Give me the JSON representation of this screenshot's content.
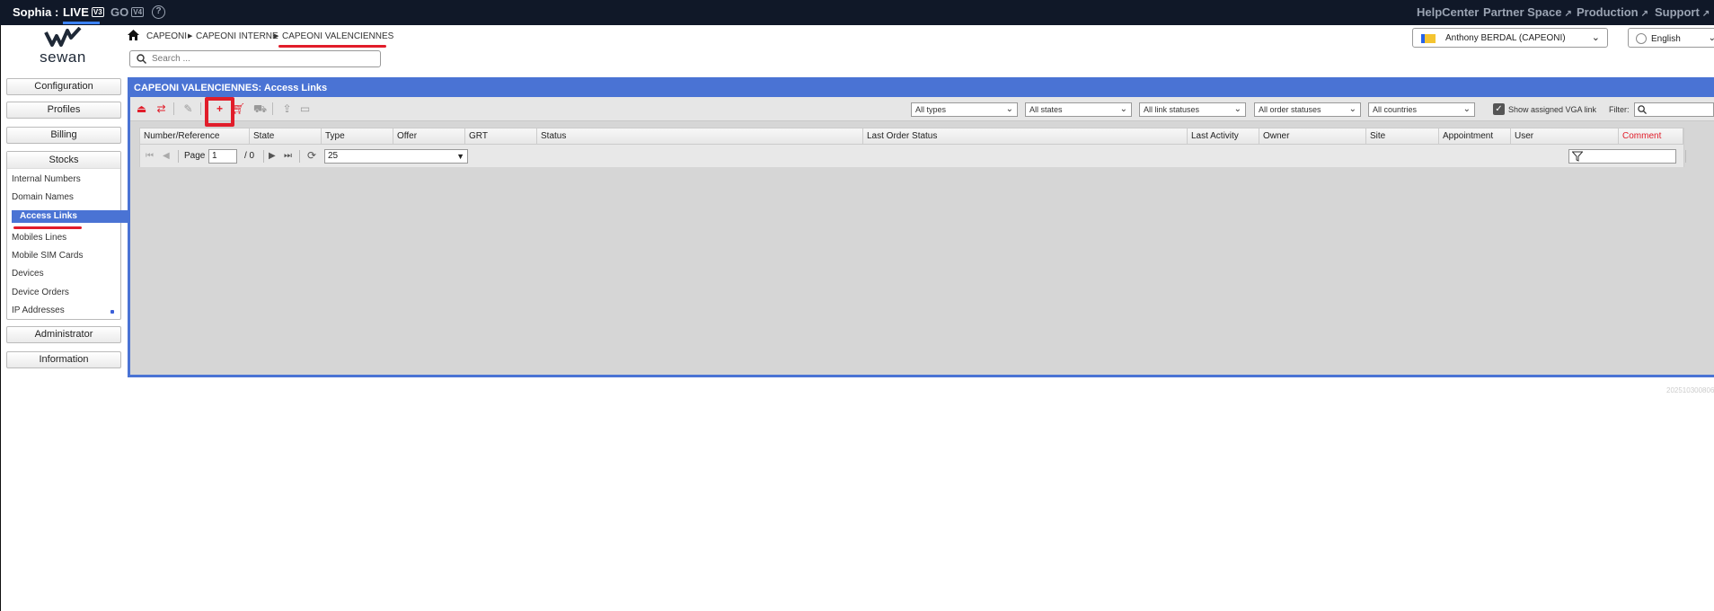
{
  "topbar": {
    "brand": "Sophia :",
    "live": "LIVE",
    "live_version": "V3",
    "go": "GO",
    "go_version": "V4",
    "help": "?",
    "links": [
      "HelpCenter",
      "Partner Space",
      "Production",
      "Support"
    ],
    "external_icon": "↗"
  },
  "logo": {
    "text": "sewan"
  },
  "breadcrumb": {
    "items": [
      "CAPEONI",
      "CAPEONI INTERNE",
      "CAPEONI VALENCIENNES"
    ],
    "separator": "▶"
  },
  "search": {
    "placeholder": "Search ..."
  },
  "user": {
    "name": "Anthony BERDAL (CAPEONI)"
  },
  "language": {
    "label": "English"
  },
  "menu": {
    "configuration": "Configuration",
    "profiles": "Profiles",
    "billing": "Billing",
    "stocks": "Stocks",
    "stocks_items": [
      "Internal Numbers",
      "Domain Names",
      "Access Links",
      "Mobiles Lines",
      "Mobile SIM Cards",
      "Devices",
      "Device Orders",
      "IP Addresses"
    ],
    "administrator": "Administrator",
    "information": "Information"
  },
  "panel": {
    "title": "CAPEONI VALENCIENNES: Access Links",
    "filters": {
      "types": "All types",
      "states": "All states",
      "link_statuses": "All link statuses",
      "order_statuses": "All order statuses",
      "countries": "All countries",
      "show_vga_label": "Show assigned VGA link",
      "show_vga_checked": true,
      "filter_label": "Filter:"
    },
    "columns": [
      "Number/Reference",
      "State",
      "Type",
      "Offer",
      "GRT",
      "Status",
      "Last Order Status",
      "Last Activity",
      "Owner",
      "Site",
      "Appointment date",
      "User",
      "Comment"
    ],
    "pager": {
      "page_label": "Page",
      "page_value": "1",
      "page_of": "/ 0",
      "page_size": "25"
    }
  },
  "build": "20251030080609",
  "colors": {
    "topbar": "#101828",
    "accent": "#4a73d4",
    "highlight": "#e11d2a"
  }
}
